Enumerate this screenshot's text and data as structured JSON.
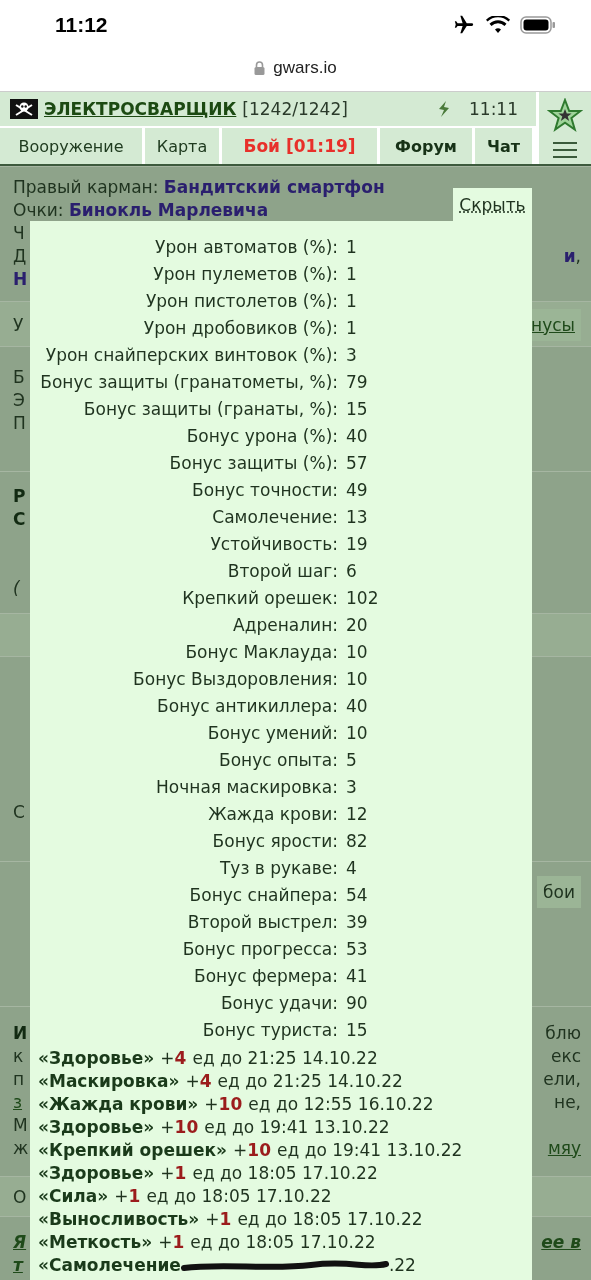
{
  "status_bar": {
    "time": "11:12"
  },
  "address_bar": {
    "url": "gwars.io"
  },
  "header": {
    "player": "ЭЛЕКТРОСВАРЩИК",
    "hp": "[1242/1242]",
    "time": "11:11"
  },
  "nav_tabs": [
    {
      "label": "Вооружение",
      "kind": "normal"
    },
    {
      "label": "Карта",
      "kind": "normal"
    },
    {
      "label": "Бой [01:19]",
      "kind": "alert"
    },
    {
      "label": "Форум",
      "kind": "bold"
    },
    {
      "label": "Чат",
      "kind": "bold"
    }
  ],
  "background_sections": [
    {
      "kind": "plain",
      "lines": [
        {
          "left": [
            {
              "text": "Правый карман: ",
              "kind": "plain"
            },
            {
              "text": "Бандитский смартфон",
              "kind": "item"
            }
          ]
        },
        {
          "left": [
            {
              "text": "Очки: ",
              "kind": "plain"
            },
            {
              "text": "Бинокль Марлевича",
              "kind": "item"
            }
          ]
        },
        {
          "left": [
            {
              "text": "Ч",
              "kind": "plain"
            }
          ]
        },
        {
          "left": [
            {
              "text": "Д",
              "kind": "plain"
            }
          ],
          "right": [
            {
              "text": "и",
              "kind": "item"
            },
            {
              "text": ",",
              "kind": "plain"
            }
          ]
        },
        {
          "left": [
            {
              "text": "Н",
              "kind": "item"
            }
          ]
        }
      ]
    },
    {
      "kind": "band",
      "lines": [
        {
          "left": [
            {
              "text": "У",
              "kind": "plain"
            }
          ],
          "right": [
            {
              "text": "нусы",
              "kind": "link-button"
            }
          ]
        }
      ]
    },
    {
      "kind": "plain",
      "lines": [
        {
          "left": [
            {
              "text": "Б",
              "kind": "plain"
            }
          ]
        },
        {
          "left": [
            {
              "text": "Э",
              "kind": "plain"
            }
          ]
        },
        {
          "left": [
            {
              "text": "П",
              "kind": "plain"
            }
          ]
        }
      ]
    },
    {
      "kind": "plain",
      "lines": [
        {
          "left": [
            {
              "text": "Р",
              "kind": "bold"
            }
          ]
        },
        {
          "left": [
            {
              "text": "С",
              "kind": "bold"
            }
          ]
        }
      ]
    },
    {
      "kind": "continued",
      "lines": [
        {
          "left": [
            {
              "text": "(",
              "kind": "italic"
            }
          ]
        }
      ]
    },
    {
      "kind": "band"
    },
    {
      "kind": "plain",
      "lines": [
        {
          "left": [
            {
              "text": "С",
              "kind": "plain"
            }
          ]
        }
      ]
    },
    {
      "kind": "plain",
      "lines": [
        {
          "right": [
            {
              "text": "бои",
              "kind": "button"
            }
          ]
        }
      ]
    },
    {
      "kind": "plain",
      "lines": [
        {
          "left": [
            {
              "text": "И",
              "kind": "bold"
            }
          ],
          "right": [
            {
              "text": "блю",
              "kind": "plain"
            }
          ]
        },
        {
          "left": [
            {
              "text": "к",
              "kind": "plain"
            }
          ],
          "right": [
            {
              "text": "екс",
              "kind": "plain"
            }
          ]
        },
        {
          "left": [
            {
              "text": "п",
              "kind": "plain"
            }
          ],
          "right": [
            {
              "text": "ели,",
              "kind": "plain"
            }
          ]
        },
        {
          "left": [
            {
              "text": "з",
              "kind": "link"
            }
          ],
          "right": [
            {
              "text": "не,",
              "kind": "plain"
            }
          ]
        },
        {
          "left": [
            {
              "text": "М",
              "kind": "plain"
            }
          ]
        },
        {
          "left": [
            {
              "text": "ж",
              "kind": "plain"
            }
          ],
          "right": [
            {
              "text": "мяу",
              "kind": "link"
            }
          ]
        }
      ]
    },
    {
      "kind": "band",
      "lines": [
        {
          "left": [
            {
              "text": "О",
              "kind": "plain"
            }
          ]
        }
      ]
    },
    {
      "kind": "plain",
      "lines": [
        {
          "left": [
            {
              "text": "Я",
              "kind": "bold-link"
            }
          ],
          "right": [
            {
              "text": "ее в",
              "kind": "bold-link"
            }
          ]
        },
        {
          "left": [
            {
              "text": "т",
              "kind": "bold-link"
            }
          ]
        }
      ]
    }
  ],
  "popup": {
    "close_label": "Скрыть",
    "stats": [
      {
        "label": "Урон автоматов (%):",
        "value": "1"
      },
      {
        "label": "Урон пулеметов (%):",
        "value": "1"
      },
      {
        "label": "Урон пистолетов (%):",
        "value": "1"
      },
      {
        "label": "Урон дробовиков (%):",
        "value": "1"
      },
      {
        "label": "Урон снайперских винтовок (%):",
        "value": "3"
      },
      {
        "label": "Бонус защиты (гранатометы, %):",
        "value": "79"
      },
      {
        "label": "Бонус защиты (гранаты, %):",
        "value": "15"
      },
      {
        "label": "Бонус урона (%):",
        "value": "40"
      },
      {
        "label": "Бонус защиты (%):",
        "value": "57"
      },
      {
        "label": "Бонус точности:",
        "value": "49"
      },
      {
        "label": "Самолечение:",
        "value": "13"
      },
      {
        "label": "Устойчивость:",
        "value": "19"
      },
      {
        "label": "Второй шаг:",
        "value": "6"
      },
      {
        "label": "Крепкий орешек:",
        "value": "102"
      },
      {
        "label": "Адреналин:",
        "value": "20"
      },
      {
        "label": "Бонус Маклауда:",
        "value": "10"
      },
      {
        "label": "Бонус Выздоровления:",
        "value": "10"
      },
      {
        "label": "Бонус антикиллера:",
        "value": "40"
      },
      {
        "label": "Бонус умений:",
        "value": "10"
      },
      {
        "label": "Бонус опыта:",
        "value": "5"
      },
      {
        "label": "Ночная маскировка:",
        "value": "3"
      },
      {
        "label": "Жажда крови:",
        "value": "12"
      },
      {
        "label": "Бонус ярости:",
        "value": "82"
      },
      {
        "label": "Туз в рукаве:",
        "value": "4"
      },
      {
        "label": "Бонус снайпера:",
        "value": "54"
      },
      {
        "label": "Второй выстрел:",
        "value": "39"
      },
      {
        "label": "Бонус прогресса:",
        "value": "53"
      },
      {
        "label": "Бонус фермера:",
        "value": "41"
      },
      {
        "label": "Бонус удачи:",
        "value": "90"
      },
      {
        "label": "Бонус туриста:",
        "value": "15"
      }
    ],
    "buffs": [
      {
        "kind": "normal",
        "name": "«Здоровье»",
        "prefix": "+",
        "amount": "4",
        "rest": "ед до 21:25 14.10.22"
      },
      {
        "kind": "normal",
        "name": "«Маскировка»",
        "prefix": "+",
        "amount": "4",
        "rest": "ед до 21:25 14.10.22"
      },
      {
        "kind": "normal",
        "name": "«Жажда крови»",
        "prefix": "+",
        "amount": "10",
        "rest": "ед до 12:55 16.10.22"
      },
      {
        "kind": "normal",
        "name": "«Здоровье»",
        "prefix": "+",
        "amount": "10",
        "rest": "ед до 19:41 13.10.22"
      },
      {
        "kind": "normal",
        "name": "«Крепкий орешек»",
        "prefix": "+",
        "amount": "10",
        "rest": "ед до 19:41 13.10.22"
      },
      {
        "kind": "normal",
        "name": "«Здоровье»",
        "prefix": "+",
        "amount": "1",
        "rest": "ед до 18:05 17.10.22"
      },
      {
        "kind": "normal",
        "name": "«Сила»",
        "prefix": "+",
        "amount": "1",
        "rest": "ед до 18:05 17.10.22"
      },
      {
        "kind": "normal",
        "name": "«Выносливость»",
        "prefix": "+",
        "amount": "1",
        "rest": "ед до 18:05 17.10.22"
      },
      {
        "kind": "normal",
        "name": "«Меткость»",
        "prefix": "+",
        "amount": "1",
        "rest": "ед до 18:05 17.10.22"
      },
      {
        "kind": "scribbled",
        "name": "«Самолечение",
        "rest": ".22"
      }
    ]
  }
}
